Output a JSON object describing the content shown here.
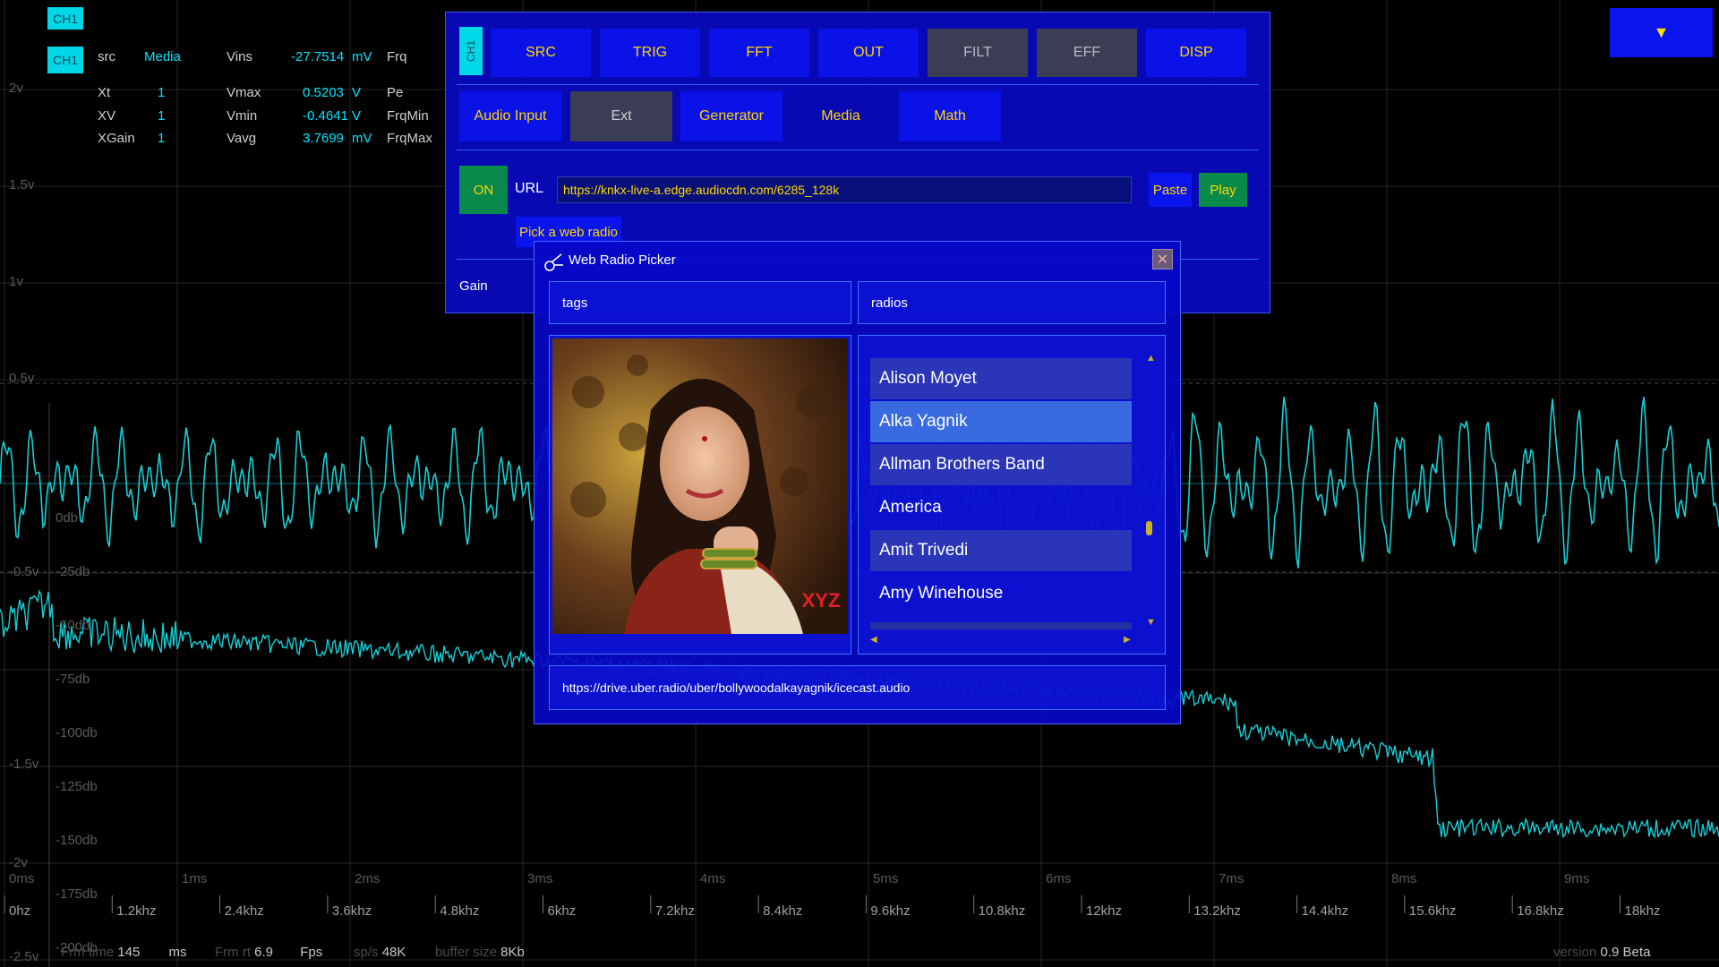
{
  "scope": {
    "volt_labels": [
      "2v",
      "1.5v",
      "1v",
      "0.5v",
      "0db",
      "-0.5v",
      "-25db",
      "-50db",
      "-75db",
      "-100db",
      "-1.5v",
      "-125db",
      "-150db",
      "-2v",
      "-175db",
      "-200db",
      "-2.5v"
    ],
    "time_labels": [
      "0ms",
      "1ms",
      "2ms",
      "3ms",
      "4ms",
      "5ms",
      "6ms",
      "7ms",
      "8ms",
      "9ms"
    ],
    "freq_labels": [
      "0hz",
      "1.2khz",
      "2.4khz",
      "3.6khz",
      "4.8khz",
      "6khz",
      "7.2khz",
      "8.4khz",
      "9.6khz",
      "10.8khz",
      "12khz",
      "13.2khz",
      "14.4khz",
      "15.6khz",
      "16.8khz",
      "18khz"
    ],
    "trace_color": "#15cfd6"
  },
  "measurements": {
    "ch1_top": "CH1",
    "ch1": "CH1",
    "rows": [
      {
        "k1": "src",
        "v1": "Media",
        "k2": "Vins",
        "v2": "-27.7514",
        "u2": "mV",
        "k3": "Frq"
      },
      {
        "k1": "Xt",
        "v1": "1",
        "k2": "Vmax",
        "v2": "0.5203",
        "u2": "V",
        "k3": "Pe"
      },
      {
        "k1": "XV",
        "v1": "1",
        "k2": "Vmin",
        "v2": "-0.4641",
        "u2": "V",
        "k3": "FrqMin"
      },
      {
        "k1": "XGain",
        "v1": "1",
        "k2": "Vavg",
        "v2": "3.7699",
        "u2": "mV",
        "k3": "FrqMax"
      }
    ]
  },
  "status": {
    "frame_time_label": "Frm time",
    "frame_time": "145",
    "frame_time_unit": "ms",
    "frm_rate_label": "Frm rt",
    "frm_rate": "6.9",
    "fps_label": "Fps",
    "sps_label": "sp/s",
    "sps": "48K",
    "buffer_label": "buffer size",
    "buffer": "8Kb",
    "version_label": "version",
    "version": "0.9 Beta"
  },
  "menu_button": {
    "icon": "▼"
  },
  "panel": {
    "channel_tag": "CH1",
    "tabs": [
      "SRC",
      "TRIG",
      "FFT",
      "OUT",
      "FILT",
      "EFF",
      "DISP"
    ],
    "sources": [
      "Audio Input",
      "Ext",
      "Generator",
      "Media",
      "Math"
    ],
    "on_label": "ON",
    "url_label": "URL",
    "url_value": "https://knkx-live-a.edge.audiocdn.com/6285_128k",
    "paste_label": "Paste",
    "play_label": "Play",
    "pick_label": "Pick a web radio",
    "gain_label": "Gain",
    "colors": {
      "accent": "#ffd800",
      "on_green": "#0a8a4a"
    }
  },
  "dialog": {
    "title": "Web Radio Picker",
    "tags_label": "tags",
    "radios_label": "radios",
    "radios": [
      "Alison Moyet",
      "Alka Yagnik",
      "Allman Brothers Band",
      "America",
      "Amit Trivedi",
      "Amy Winehouse"
    ],
    "selected_index": 1,
    "stream_url": "https://drive.uber.radio/uber/bollywoodalkayagnik/icecast.audio",
    "photo_watermark": "XYZ"
  }
}
